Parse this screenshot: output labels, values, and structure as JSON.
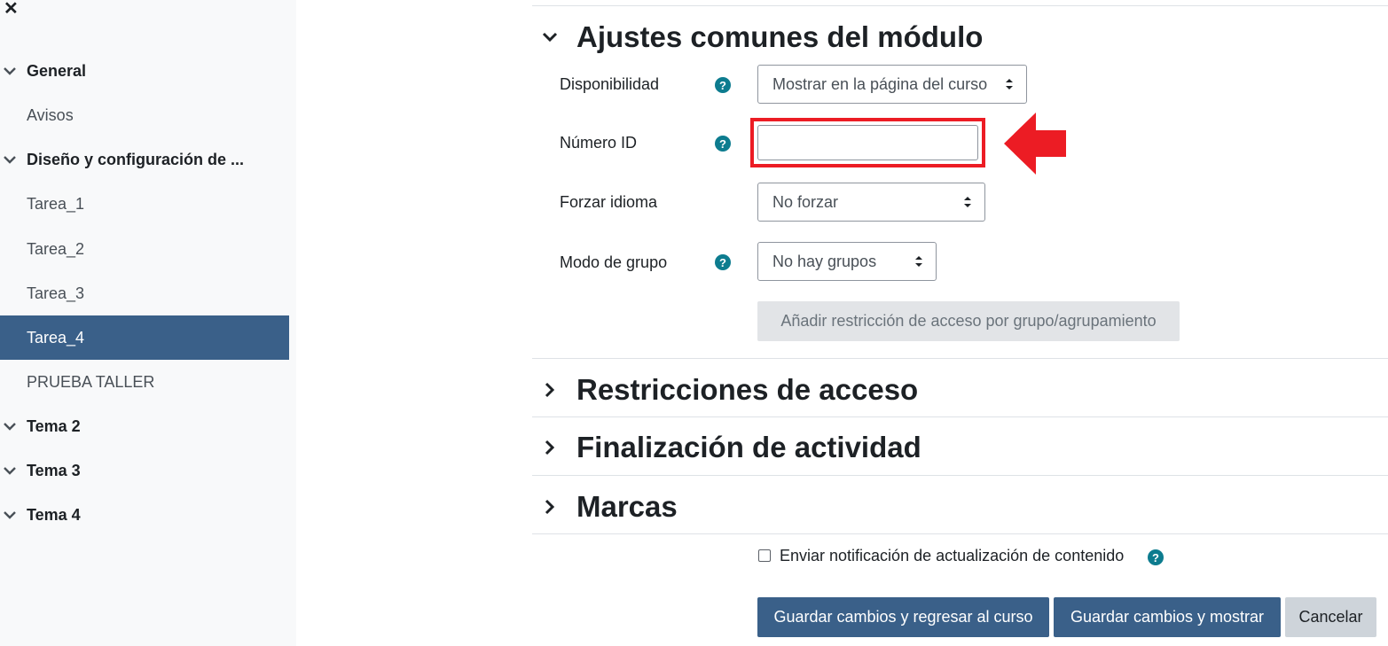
{
  "sidebar": {
    "close_icon": "close-icon",
    "items": [
      {
        "label": "General",
        "type": "section"
      },
      {
        "label": "Avisos",
        "type": "item"
      },
      {
        "label": "Diseño y configuración de ...",
        "type": "section"
      },
      {
        "label": "Tarea_1",
        "type": "item"
      },
      {
        "label": "Tarea_2",
        "type": "item"
      },
      {
        "label": "Tarea_3",
        "type": "item"
      },
      {
        "label": "Tarea_4",
        "type": "item",
        "active": true
      },
      {
        "label": "PRUEBA TALLER",
        "type": "item"
      },
      {
        "label": "Tema 2",
        "type": "section"
      },
      {
        "label": "Tema 3",
        "type": "section"
      },
      {
        "label": "Tema 4",
        "type": "section"
      }
    ]
  },
  "main": {
    "sections": {
      "common": {
        "title": "Ajustes comunes del módulo",
        "expanded": true
      },
      "access": {
        "title": "Restricciones de acceso",
        "expanded": false
      },
      "completion": {
        "title": "Finalización de actividad",
        "expanded": false
      },
      "tags": {
        "title": "Marcas",
        "expanded": false
      }
    },
    "fields": {
      "availability": {
        "label": "Disponibilidad",
        "value": "Mostrar en la página del curso"
      },
      "idnumber": {
        "label": "Número ID",
        "value": ""
      },
      "language": {
        "label": "Forzar idioma",
        "value": "No forzar"
      },
      "groupmode": {
        "label": "Modo de grupo",
        "value": "No hay grupos"
      }
    },
    "restriction_button": "Añadir restricción de acceso por grupo/agrupamiento",
    "notify_label": "Enviar notificación de actualización de contenido",
    "buttons": {
      "save_return": "Guardar cambios y regresar al curso",
      "save_display": "Guardar cambios y mostrar",
      "cancel": "Cancelar"
    }
  },
  "colors": {
    "accent": "#3a6089",
    "help_icon": "#0d7c8f",
    "highlight": "#ec1c24"
  }
}
